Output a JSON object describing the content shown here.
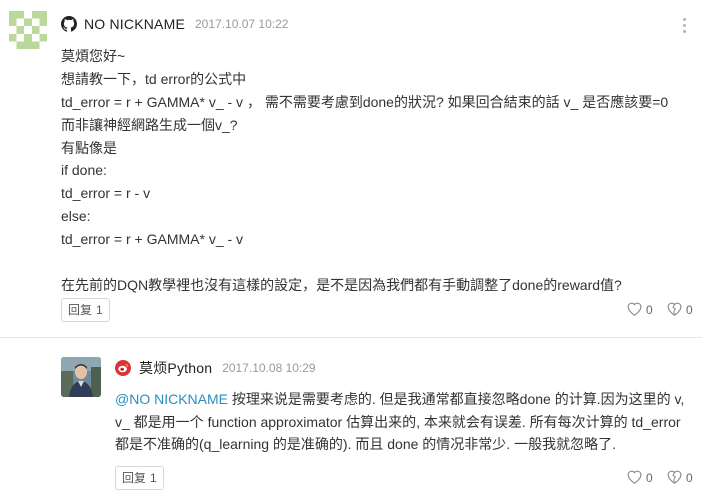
{
  "comment": {
    "author": "NO NICKNAME",
    "timestamp": "2017.10.07 10:22",
    "lines": [
      "莫煩您好~",
      "想請教一下，td error的公式中",
      "td_error = r + GAMMA* v_ - v ， 需不需要考慮到done的狀況? 如果回合結束的話 v_ 是否應該要=0",
      "而非讓神經網路生成一個v_?",
      "有點像是",
      "if done:",
      "td_error = r - v",
      "else:",
      "td_error = r + GAMMA* v_ - v",
      "",
      "在先前的DQN教學裡也沒有這樣的設定，是不是因為我們都有手動調整了done的reward值?"
    ],
    "reply_label": "回复",
    "reply_count": "1",
    "like_count": "0",
    "dislike_count": "0"
  },
  "reply": {
    "author": "莫烦Python",
    "timestamp": "2017.10.08 10:29",
    "mention": "@NO NICKNAME",
    "line1_rest": " 按理来说是需要考虑的. 但是我通常都直接忽略done 的计算.因为这里的 v,",
    "line2": "v_ 都是用一个 function approximator 估算出来的, 本来就会有误差. 所有每次计算的 td_error",
    "line3": "都是不准确的(q_learning 的是准确的). 而且 done 的情况非常少. 一般我就忽略了.",
    "reply_label": "回复",
    "reply_count": "1",
    "like_count": "0",
    "dislike_count": "0"
  },
  "colors": {
    "mention": "#2a8fbd",
    "identicon": "#b9d89a",
    "weibo": "#d9333a"
  },
  "icons": {
    "platform": "github-icon",
    "reply_platform": "weibo-icon",
    "like": "heart-icon",
    "dislike": "broken-heart-icon",
    "menu": "more-vertical-icon"
  }
}
